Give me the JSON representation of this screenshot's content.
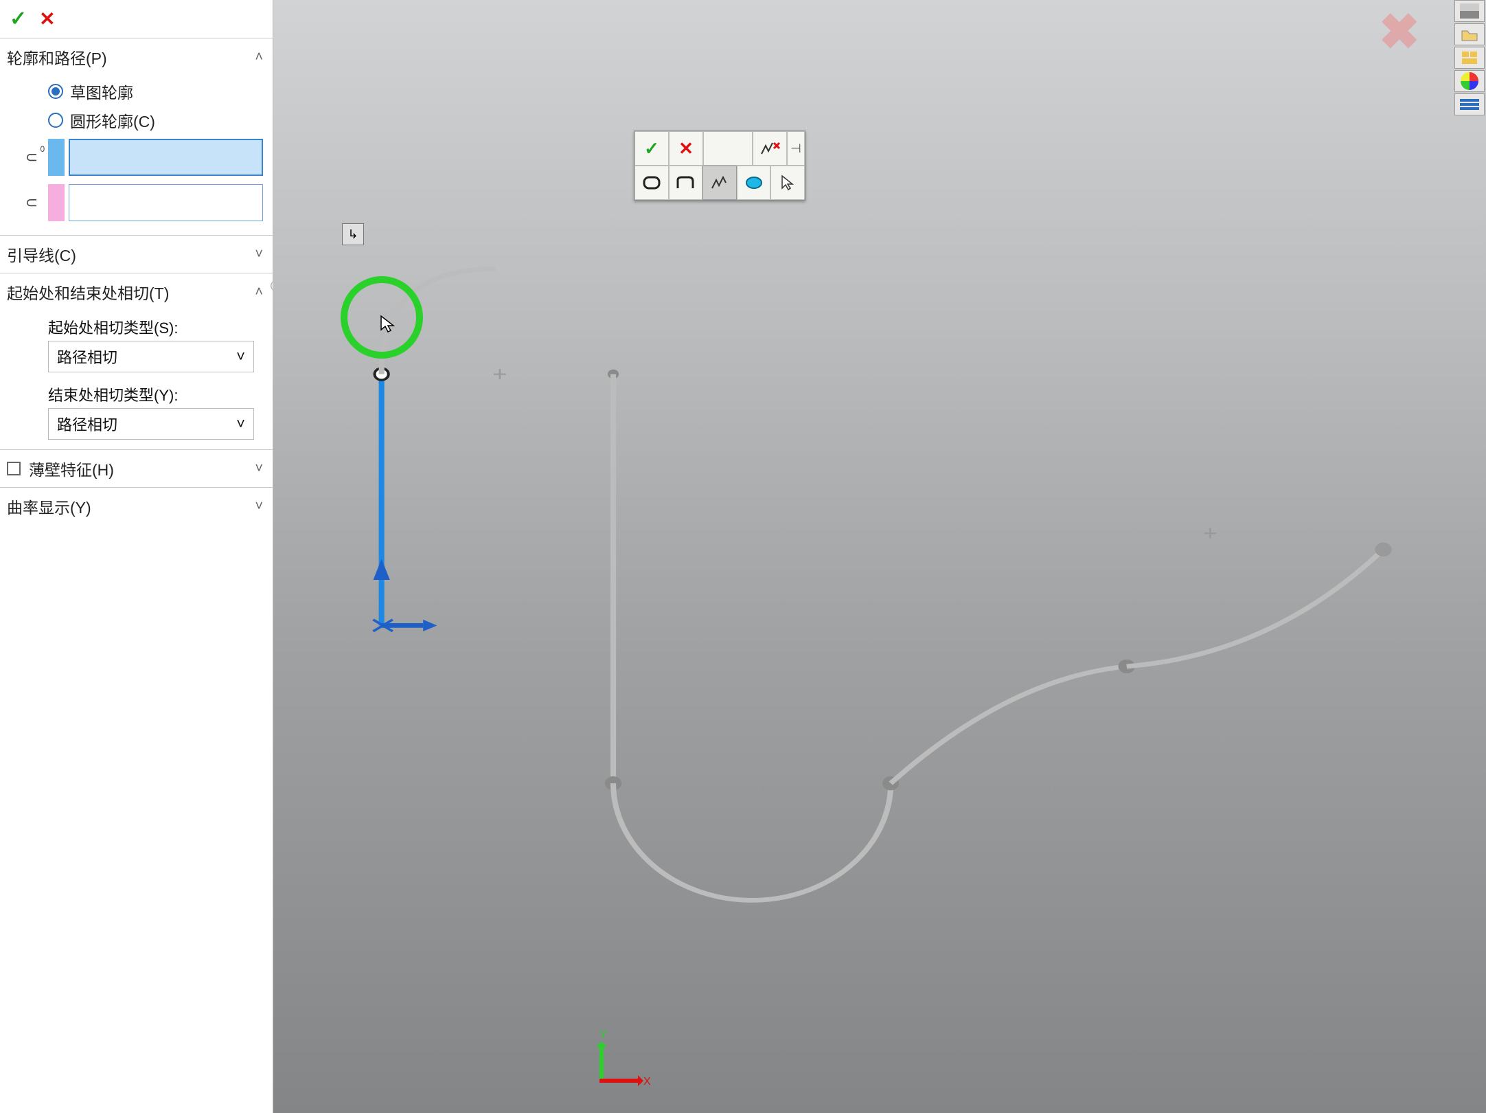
{
  "panel": {
    "sections": {
      "profile_path": {
        "title": "轮廓和路径(P)",
        "expanded": true,
        "options": {
          "sketch_profile": "草图轮廓",
          "circular_profile": "圆形轮廓(C)"
        },
        "profile_badge": "0"
      },
      "guides": {
        "title": "引导线(C)",
        "expanded": false
      },
      "tangency": {
        "title": "起始处和结束处相切(T)",
        "expanded": true,
        "start_label": "起始处相切类型(S):",
        "start_value": "路径相切",
        "end_label": "结束处相切类型(Y):",
        "end_value": "路径相切"
      },
      "thin": {
        "title": "薄壁特征(H)",
        "expanded": false
      },
      "curvature": {
        "title": "曲率显示(Y)",
        "expanded": false
      }
    }
  },
  "triad": {
    "x": "X",
    "y": "Y"
  }
}
